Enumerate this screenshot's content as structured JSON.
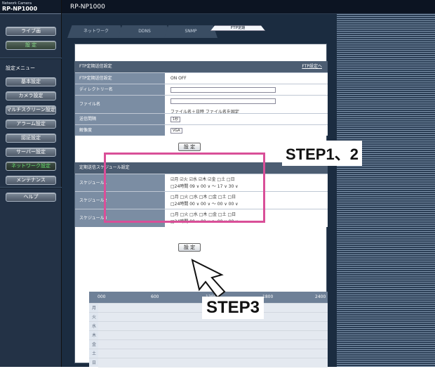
{
  "brand": {
    "small": "Network Camera",
    "model": "RP-NP1000"
  },
  "header": {
    "title": "RP-NP1000"
  },
  "sidebar": {
    "top_buttons": [
      "ライブ画",
      "設 定"
    ],
    "settings_menu_label": "設定メニュー",
    "items": [
      "基本設定",
      "カメラ設定",
      "マルチスクリーン設定",
      "アラーム設定",
      "認証設定",
      "サーバー設定",
      "ネットワーク設定",
      "メンテナンス"
    ],
    "help": "ヘルプ"
  },
  "tabs": [
    "ネットワーク",
    "DDNS",
    "SNMP",
    "FTP定期"
  ],
  "ftp": {
    "section_title": "FTP定期送信設定",
    "link": "FTP設定へ",
    "rows": [
      {
        "label": "FTP定期送信設定",
        "value": "ON  OFF"
      },
      {
        "label": "ディレクトリー名",
        "value": ""
      },
      {
        "label": "ファイル名",
        "value": "ファイル名＋日時  ファイル名を固定"
      },
      {
        "label": "送信間隔",
        "value": "1秒"
      },
      {
        "label": "解像度",
        "value": "VGA"
      }
    ],
    "set_button": "設 定"
  },
  "schedule": {
    "section_title": "定期送信スケジュール設定",
    "rows": [
      {
        "label": "スケジュール1",
        "days": "☑月 ☑火 ☑水 ☑木 ☑金 □土 □日",
        "time": "□24時間 09 ∨ 00 ∨ ～ 17 ∨ 30 ∨"
      },
      {
        "label": "スケジュール2",
        "days": "□月 □火 □水 □木 □金 □土 □日",
        "time": "□24時間 00 ∨ 00 ∨ ～ 00 ∨ 00 ∨"
      },
      {
        "label": "スケジュール3",
        "days": "□月 □火 □水 □木 □金 □土 □日",
        "time": "□24時間 00 ∨ 00 ∨ ～ 00 ∨ 00 ∨"
      }
    ],
    "set_button": "設 定"
  },
  "timeline": {
    "ticks": [
      "000",
      "600",
      "1200",
      "1800",
      "2400"
    ],
    "days": [
      "月",
      "火",
      "水",
      "木",
      "金",
      "土",
      "日"
    ]
  },
  "annotations": {
    "step12": "STEP1、2",
    "step3": "STEP3"
  }
}
